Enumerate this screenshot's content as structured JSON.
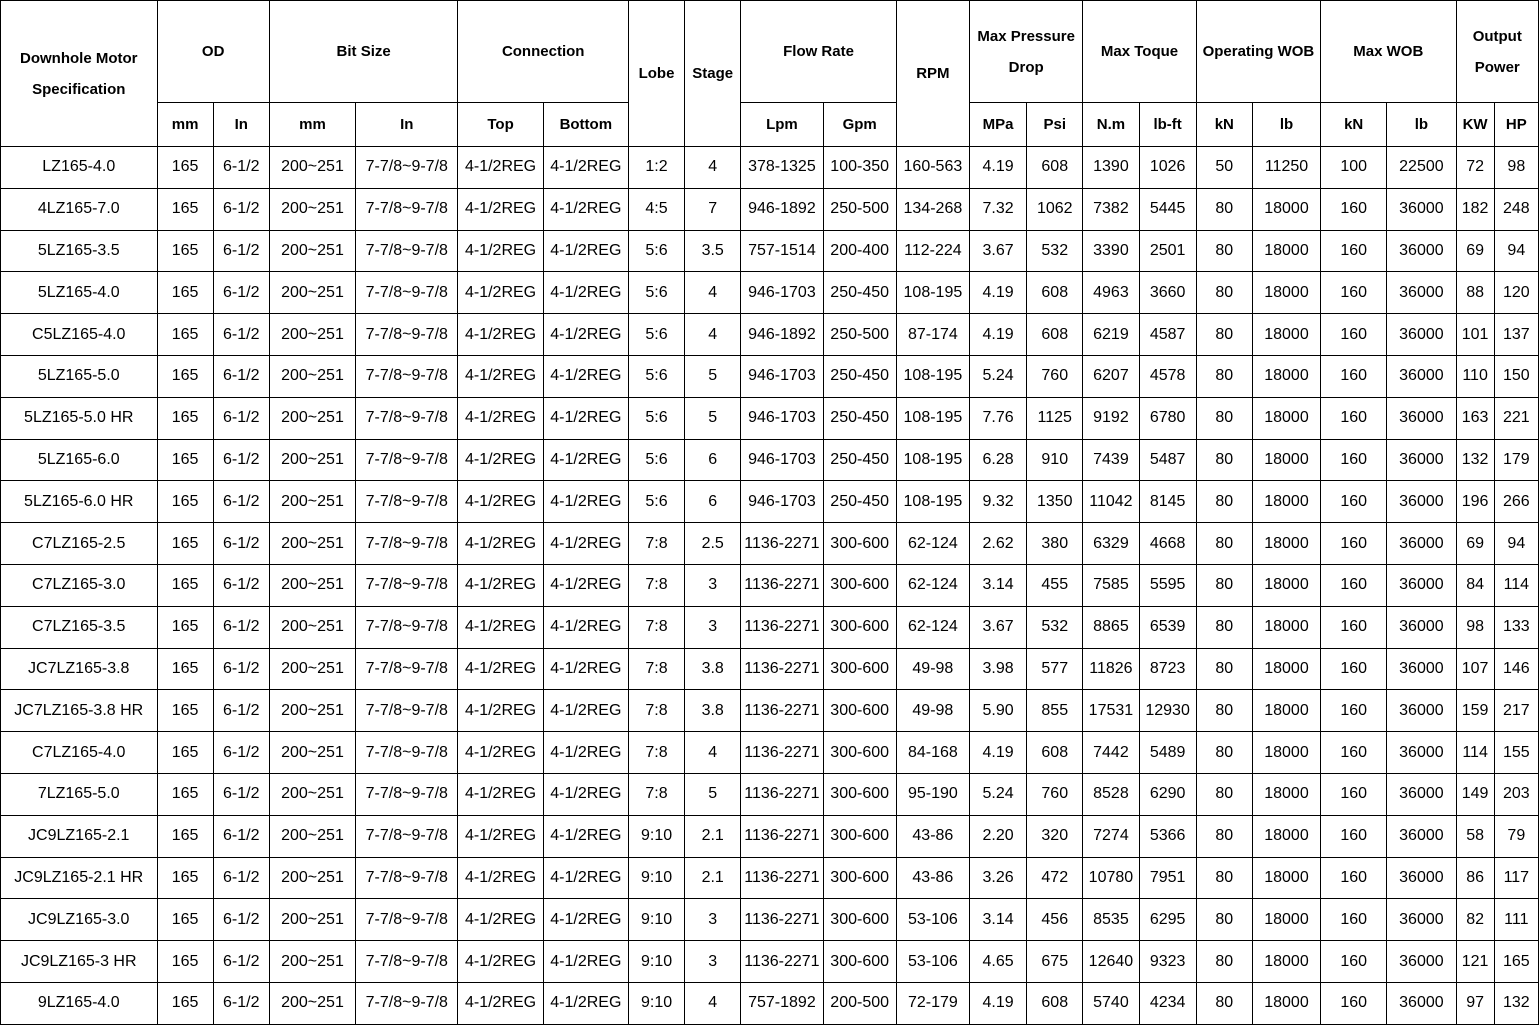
{
  "table": {
    "header_top": {
      "spec": "Downhole Motor Specification",
      "od": "OD",
      "bit_size": "Bit Size",
      "connection": "Connection",
      "lobe": "Lobe",
      "stage": "Stage",
      "flow_rate": "Flow Rate",
      "rpm": "RPM",
      "max_pressure_drop": "Max Pressure Drop",
      "max_toque": "Max Toque",
      "operating_wob": "Operating WOB",
      "max_wob": "Max WOB",
      "output_power": "Output Power"
    },
    "header_units": [
      "mm",
      "In",
      "mm",
      "In",
      "Top",
      "Bottom",
      "Lpm",
      "Gpm",
      "MPa",
      "Psi",
      "N.m",
      "lb-ft",
      "kN",
      "lb",
      "kN",
      "lb",
      "KW",
      "HP"
    ],
    "rows": [
      [
        "LZ165-4.0",
        "165",
        "6-1/2",
        "200~251",
        "7-7/8~9-7/8",
        "4-1/2REG",
        "4-1/2REG",
        "1:2",
        "4",
        "378-1325",
        "100-350",
        "160-563",
        "4.19",
        "608",
        "1390",
        "1026",
        "50",
        "11250",
        "100",
        "22500",
        "72",
        "98"
      ],
      [
        "4LZ165-7.0",
        "165",
        "6-1/2",
        "200~251",
        "7-7/8~9-7/8",
        "4-1/2REG",
        "4-1/2REG",
        "4:5",
        "7",
        "946-1892",
        "250-500",
        "134-268",
        "7.32",
        "1062",
        "7382",
        "5445",
        "80",
        "18000",
        "160",
        "36000",
        "182",
        "248"
      ],
      [
        "5LZ165-3.5",
        "165",
        "6-1/2",
        "200~251",
        "7-7/8~9-7/8",
        "4-1/2REG",
        "4-1/2REG",
        "5:6",
        "3.5",
        "757-1514",
        "200-400",
        "112-224",
        "3.67",
        "532",
        "3390",
        "2501",
        "80",
        "18000",
        "160",
        "36000",
        "69",
        "94"
      ],
      [
        "5LZ165-4.0",
        "165",
        "6-1/2",
        "200~251",
        "7-7/8~9-7/8",
        "4-1/2REG",
        "4-1/2REG",
        "5:6",
        "4",
        "946-1703",
        "250-450",
        "108-195",
        "4.19",
        "608",
        "4963",
        "3660",
        "80",
        "18000",
        "160",
        "36000",
        "88",
        "120"
      ],
      [
        "C5LZ165-4.0",
        "165",
        "6-1/2",
        "200~251",
        "7-7/8~9-7/8",
        "4-1/2REG",
        "4-1/2REG",
        "5:6",
        "4",
        "946-1892",
        "250-500",
        "87-174",
        "4.19",
        "608",
        "6219",
        "4587",
        "80",
        "18000",
        "160",
        "36000",
        "101",
        "137"
      ],
      [
        "5LZ165-5.0",
        "165",
        "6-1/2",
        "200~251",
        "7-7/8~9-7/8",
        "4-1/2REG",
        "4-1/2REG",
        "5:6",
        "5",
        "946-1703",
        "250-450",
        "108-195",
        "5.24",
        "760",
        "6207",
        "4578",
        "80",
        "18000",
        "160",
        "36000",
        "110",
        "150"
      ],
      [
        "5LZ165-5.0 HR",
        "165",
        "6-1/2",
        "200~251",
        "7-7/8~9-7/8",
        "4-1/2REG",
        "4-1/2REG",
        "5:6",
        "5",
        "946-1703",
        "250-450",
        "108-195",
        "7.76",
        "1125",
        "9192",
        "6780",
        "80",
        "18000",
        "160",
        "36000",
        "163",
        "221"
      ],
      [
        "5LZ165-6.0",
        "165",
        "6-1/2",
        "200~251",
        "7-7/8~9-7/8",
        "4-1/2REG",
        "4-1/2REG",
        "5:6",
        "6",
        "946-1703",
        "250-450",
        "108-195",
        "6.28",
        "910",
        "7439",
        "5487",
        "80",
        "18000",
        "160",
        "36000",
        "132",
        "179"
      ],
      [
        "5LZ165-6.0 HR",
        "165",
        "6-1/2",
        "200~251",
        "7-7/8~9-7/8",
        "4-1/2REG",
        "4-1/2REG",
        "5:6",
        "6",
        "946-1703",
        "250-450",
        "108-195",
        "9.32",
        "1350",
        "11042",
        "8145",
        "80",
        "18000",
        "160",
        "36000",
        "196",
        "266"
      ],
      [
        "C7LZ165-2.5",
        "165",
        "6-1/2",
        "200~251",
        "7-7/8~9-7/8",
        "4-1/2REG",
        "4-1/2REG",
        "7:8",
        "2.5",
        "1136-2271",
        "300-600",
        "62-124",
        "2.62",
        "380",
        "6329",
        "4668",
        "80",
        "18000",
        "160",
        "36000",
        "69",
        "94"
      ],
      [
        "C7LZ165-3.0",
        "165",
        "6-1/2",
        "200~251",
        "7-7/8~9-7/8",
        "4-1/2REG",
        "4-1/2REG",
        "7:8",
        "3",
        "1136-2271",
        "300-600",
        "62-124",
        "3.14",
        "455",
        "7585",
        "5595",
        "80",
        "18000",
        "160",
        "36000",
        "84",
        "114"
      ],
      [
        "C7LZ165-3.5",
        "165",
        "6-1/2",
        "200~251",
        "7-7/8~9-7/8",
        "4-1/2REG",
        "4-1/2REG",
        "7:8",
        "3",
        "1136-2271",
        "300-600",
        "62-124",
        "3.67",
        "532",
        "8865",
        "6539",
        "80",
        "18000",
        "160",
        "36000",
        "98",
        "133"
      ],
      [
        "JC7LZ165-3.8",
        "165",
        "6-1/2",
        "200~251",
        "7-7/8~9-7/8",
        "4-1/2REG",
        "4-1/2REG",
        "7:8",
        "3.8",
        "1136-2271",
        "300-600",
        "49-98",
        "3.98",
        "577",
        "11826",
        "8723",
        "80",
        "18000",
        "160",
        "36000",
        "107",
        "146"
      ],
      [
        "JC7LZ165-3.8 HR",
        "165",
        "6-1/2",
        "200~251",
        "7-7/8~9-7/8",
        "4-1/2REG",
        "4-1/2REG",
        "7:8",
        "3.8",
        "1136-2271",
        "300-600",
        "49-98",
        "5.90",
        "855",
        "17531",
        "12930",
        "80",
        "18000",
        "160",
        "36000",
        "159",
        "217"
      ],
      [
        "C7LZ165-4.0",
        "165",
        "6-1/2",
        "200~251",
        "7-7/8~9-7/8",
        "4-1/2REG",
        "4-1/2REG",
        "7:8",
        "4",
        "1136-2271",
        "300-600",
        "84-168",
        "4.19",
        "608",
        "7442",
        "5489",
        "80",
        "18000",
        "160",
        "36000",
        "114",
        "155"
      ],
      [
        "7LZ165-5.0",
        "165",
        "6-1/2",
        "200~251",
        "7-7/8~9-7/8",
        "4-1/2REG",
        "4-1/2REG",
        "7:8",
        "5",
        "1136-2271",
        "300-600",
        "95-190",
        "5.24",
        "760",
        "8528",
        "6290",
        "80",
        "18000",
        "160",
        "36000",
        "149",
        "203"
      ],
      [
        "JC9LZ165-2.1",
        "165",
        "6-1/2",
        "200~251",
        "7-7/8~9-7/8",
        "4-1/2REG",
        "4-1/2REG",
        "9:10",
        "2.1",
        "1136-2271",
        "300-600",
        "43-86",
        "2.20",
        "320",
        "7274",
        "5366",
        "80",
        "18000",
        "160",
        "36000",
        "58",
        "79"
      ],
      [
        "JC9LZ165-2.1 HR",
        "165",
        "6-1/2",
        "200~251",
        "7-7/8~9-7/8",
        "4-1/2REG",
        "4-1/2REG",
        "9:10",
        "2.1",
        "1136-2271",
        "300-600",
        "43-86",
        "3.26",
        "472",
        "10780",
        "7951",
        "80",
        "18000",
        "160",
        "36000",
        "86",
        "117"
      ],
      [
        "JC9LZ165-3.0",
        "165",
        "6-1/2",
        "200~251",
        "7-7/8~9-7/8",
        "4-1/2REG",
        "4-1/2REG",
        "9:10",
        "3",
        "1136-2271",
        "300-600",
        "53-106",
        "3.14",
        "456",
        "8535",
        "6295",
        "80",
        "18000",
        "160",
        "36000",
        "82",
        "111"
      ],
      [
        "JC9LZ165-3 HR",
        "165",
        "6-1/2",
        "200~251",
        "7-7/8~9-7/8",
        "4-1/2REG",
        "4-1/2REG",
        "9:10",
        "3",
        "1136-2271",
        "300-600",
        "53-106",
        "4.65",
        "675",
        "12640",
        "9323",
        "80",
        "18000",
        "160",
        "36000",
        "121",
        "165"
      ],
      [
        "9LZ165-4.0",
        "165",
        "6-1/2",
        "200~251",
        "7-7/8~9-7/8",
        "4-1/2REG",
        "4-1/2REG",
        "9:10",
        "4",
        "757-1892",
        "200-500",
        "72-179",
        "4.19",
        "608",
        "5740",
        "4234",
        "80",
        "18000",
        "160",
        "36000",
        "97",
        "132"
      ]
    ]
  }
}
